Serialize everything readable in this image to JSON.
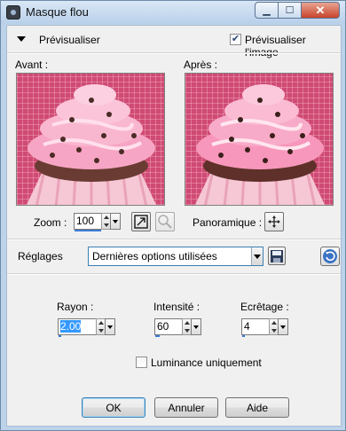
{
  "window": {
    "title": "Masque flou"
  },
  "preview": {
    "toggle_label": "Prévisualiser",
    "checkbox_label": "Prévisualiser l'image",
    "checked": true
  },
  "images": {
    "before_label": "Avant :",
    "after_label": "Après :"
  },
  "zoom": {
    "label": "Zoom :",
    "value": "100"
  },
  "pan": {
    "label": "Panoramique :"
  },
  "settings": {
    "label": "Réglages",
    "preset": "Dernières options utilisées"
  },
  "params": {
    "radius": {
      "label": "Rayon :",
      "value": "2.00"
    },
    "intensity": {
      "label": "Intensité :",
      "value": "60"
    },
    "clip": {
      "label": "Ecrêtage :",
      "value": "4"
    }
  },
  "luminance": {
    "label": "Luminance uniquement",
    "checked": false
  },
  "buttons": {
    "ok": "OK",
    "cancel": "Annuler",
    "help": "Aide"
  }
}
